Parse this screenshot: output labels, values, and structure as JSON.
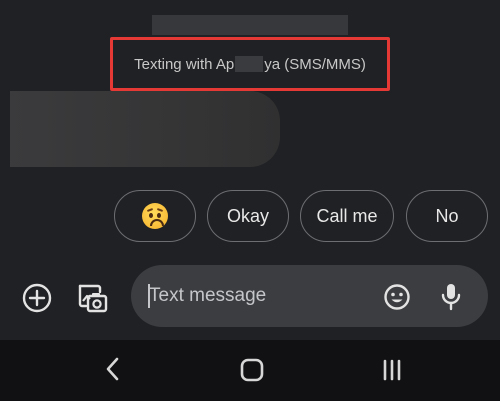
{
  "conversation": {
    "header_prefix": "Texting with Ap",
    "header_suffix": "ya (SMS/MMS)"
  },
  "smart_replies": [
    {
      "label": "",
      "icon": "worried-face-emoji"
    },
    {
      "label": "Okay"
    },
    {
      "label": "Call me"
    },
    {
      "label": "No"
    }
  ],
  "composer": {
    "placeholder": "Text message",
    "value": ""
  },
  "colors": {
    "background": "#202124",
    "highlight": "#e53935",
    "compose_field": "#3b3d40",
    "chip_border": "#6d6e72",
    "navbar": "#111113"
  },
  "icons": {
    "attach": "plus-circle-icon",
    "gallery": "image-camera-icon",
    "emoji": "emoji-icon",
    "voice": "microphone-icon",
    "nav_back": "back-chevron-icon",
    "nav_home": "home-icon",
    "nav_recents": "recents-icon"
  }
}
